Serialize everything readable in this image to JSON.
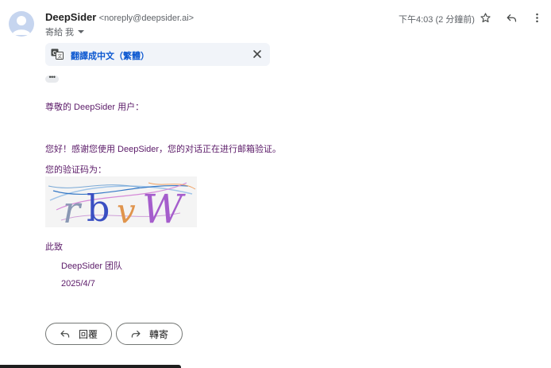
{
  "header": {
    "sender_name": "DeepSider",
    "sender_email": "<noreply@deepsider.ai>",
    "to_label": "寄給 我",
    "time": "下午4:03 (2 分鐘前)"
  },
  "translate": {
    "label": "翻譯成中文（繁體）"
  },
  "ellipsis": "•••",
  "body": {
    "greeting": "尊敬的 DeepSider 用户：",
    "line1": "您好！感谢您使用 DeepSider，您的对话正在进行邮箱验证。",
    "line2": "您的验证码为：",
    "captcha_text": "rbvW",
    "closing": "此致",
    "team": "DeepSider 团队",
    "date": "2025/4/7"
  },
  "actions": {
    "reply": "回覆",
    "forward": "轉寄"
  },
  "colors": {
    "body_text": "#5b1a68",
    "link_blue": "#0b57d0",
    "avatar_bg": "#c6d5ef"
  }
}
